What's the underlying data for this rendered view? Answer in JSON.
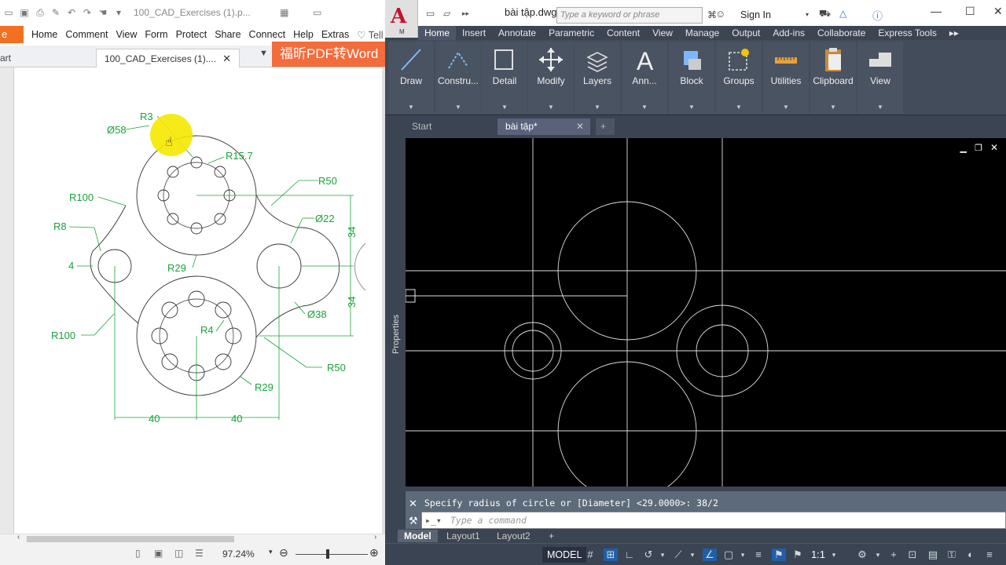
{
  "pdf": {
    "title": "100_CAD_Exercises (1).p...",
    "file_label": "e",
    "menu": [
      "Home",
      "Comment",
      "View",
      "Form",
      "Protect",
      "Share",
      "Connect",
      "Help",
      "Extras"
    ],
    "tell_label": "Tell",
    "tab_start": "art",
    "tab_doc": "100_CAD_Exercises (1)....",
    "banner": "福昕PDF转Word",
    "zoom": "97.24%",
    "dims": {
      "r3": "R3",
      "d58": "Ø58",
      "r15_7": "R15.7",
      "r50_top": "R50",
      "r100_top": "R100",
      "d22": "Ø22",
      "r8": "R8",
      "v34_top": "34",
      "four": "4",
      "r29_mid": "R29",
      "v34_bot": "34",
      "d38": "Ø38",
      "r100_bot": "R100",
      "r4": "R4",
      "r50_bot": "R50",
      "r29_bot": "R29",
      "h40_left": "40",
      "h40_right": "40"
    }
  },
  "cad": {
    "docname": "bài tập.dwg",
    "search_placeholder": "Type a keyword or phrase",
    "signin": "Sign In",
    "app_menu": "M",
    "ribbon_tabs": [
      "Home",
      "Insert",
      "Annotate",
      "Parametric",
      "Content",
      "View",
      "Manage",
      "Output",
      "Add-ins",
      "Collaborate",
      "Express Tools"
    ],
    "panels": [
      "Draw",
      "Constru...",
      "Detail",
      "Modify",
      "Layers",
      "Ann...",
      "Block",
      "Groups",
      "Utilities",
      "Clipboard",
      "View"
    ],
    "doc_tabs": {
      "start": "Start",
      "active": "bài tập*"
    },
    "properties_label": "Properties",
    "command_history": "Specify radius of circle or [Diameter] <29.0000>: 38/2",
    "command_placeholder": "Type a command",
    "layout_tabs": [
      "Model",
      "Layout1",
      "Layout2"
    ],
    "status_model": "MODEL",
    "status_scale": "1:1"
  },
  "colors": {
    "dimension_green": "#1aa33a",
    "autocad_dark": "#3b4452",
    "foxit_orange": "#f37021"
  }
}
